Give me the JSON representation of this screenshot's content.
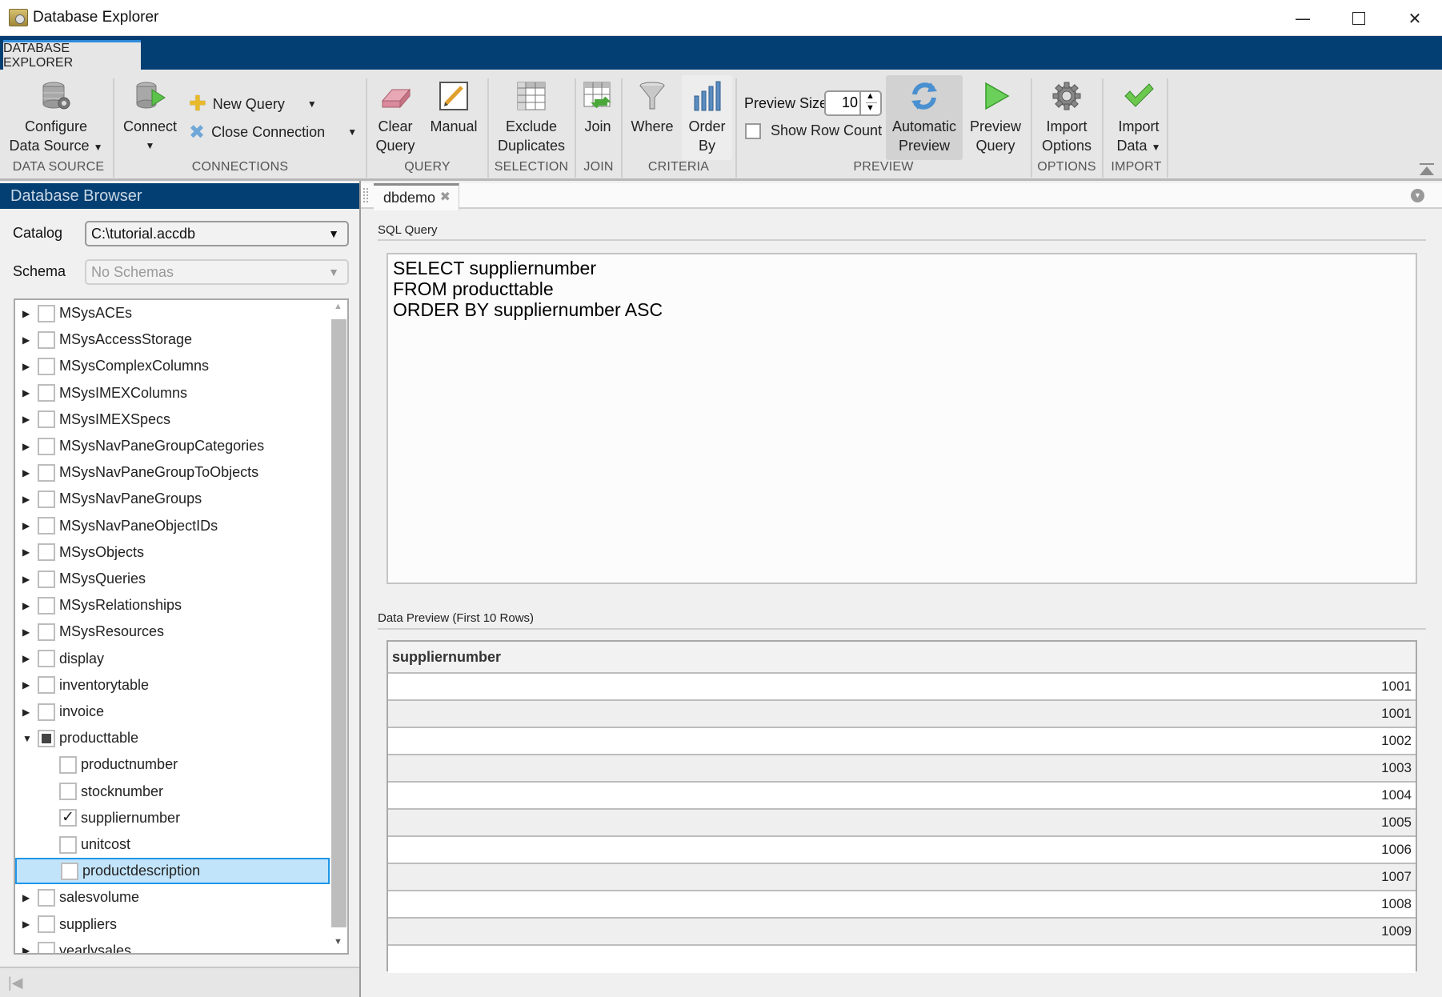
{
  "window": {
    "title": "Database Explorer",
    "controls": [
      "minimize",
      "maximize",
      "close"
    ]
  },
  "ribbon_tab": "DATABASE EXPLORER",
  "ribbon": {
    "groups": {
      "data_source": "DATA SOURCE",
      "connections": "CONNECTIONS",
      "query": "QUERY",
      "selection": "SELECTION",
      "join": "JOIN",
      "criteria": "CRITERIA",
      "preview": "PREVIEW",
      "options": "OPTIONS",
      "import": "IMPORT"
    },
    "configure": {
      "line1": "Configure",
      "line2": "Data Source"
    },
    "connect": "Connect",
    "new_query": "New Query",
    "close_connection": "Close Connection",
    "clear_query": {
      "line1": "Clear",
      "line2": "Query"
    },
    "manual": "Manual",
    "exclude_duplicates": {
      "line1": "Exclude",
      "line2": "Duplicates"
    },
    "join": "Join",
    "where": "Where",
    "order_by": {
      "line1": "Order",
      "line2": "By"
    },
    "preview_size_label": "Preview Size",
    "preview_size_value": "10",
    "show_row_count": {
      "label": "Show Row Count",
      "checked": false
    },
    "automatic_preview": {
      "line1": "Automatic",
      "line2": "Preview"
    },
    "preview_query": {
      "line1": "Preview",
      "line2": "Query"
    },
    "import_options": {
      "line1": "Import",
      "line2": "Options"
    },
    "import_data": {
      "line1": "Import",
      "line2": "Data"
    }
  },
  "browser": {
    "title": "Database Browser",
    "catalog_label": "Catalog",
    "catalog_value": "C:\\tutorial.accdb",
    "schema_label": "Schema",
    "schema_value": "No Schemas",
    "tree": [
      {
        "label": "MSysACEs",
        "level": 0,
        "expander": "collapsed",
        "check": "none"
      },
      {
        "label": "MSysAccessStorage",
        "level": 0,
        "expander": "collapsed",
        "check": "none"
      },
      {
        "label": "MSysComplexColumns",
        "level": 0,
        "expander": "collapsed",
        "check": "none"
      },
      {
        "label": "MSysIMEXColumns",
        "level": 0,
        "expander": "collapsed",
        "check": "none"
      },
      {
        "label": "MSysIMEXSpecs",
        "level": 0,
        "expander": "collapsed",
        "check": "none"
      },
      {
        "label": "MSysNavPaneGroupCategories",
        "level": 0,
        "expander": "collapsed",
        "check": "none"
      },
      {
        "label": "MSysNavPaneGroupToObjects",
        "level": 0,
        "expander": "collapsed",
        "check": "none"
      },
      {
        "label": "MSysNavPaneGroups",
        "level": 0,
        "expander": "collapsed",
        "check": "none"
      },
      {
        "label": "MSysNavPaneObjectIDs",
        "level": 0,
        "expander": "collapsed",
        "check": "none"
      },
      {
        "label": "MSysObjects",
        "level": 0,
        "expander": "collapsed",
        "check": "none"
      },
      {
        "label": "MSysQueries",
        "level": 0,
        "expander": "collapsed",
        "check": "none"
      },
      {
        "label": "MSysRelationships",
        "level": 0,
        "expander": "collapsed",
        "check": "none"
      },
      {
        "label": "MSysResources",
        "level": 0,
        "expander": "collapsed",
        "check": "none"
      },
      {
        "label": "display",
        "level": 0,
        "expander": "collapsed",
        "check": "none"
      },
      {
        "label": "inventorytable",
        "level": 0,
        "expander": "collapsed",
        "check": "none"
      },
      {
        "label": "invoice",
        "level": 0,
        "expander": "collapsed",
        "check": "none"
      },
      {
        "label": "producttable",
        "level": 0,
        "expander": "expanded",
        "check": "mixed"
      },
      {
        "label": "productnumber",
        "level": 1,
        "expander": "none",
        "check": "none"
      },
      {
        "label": "stocknumber",
        "level": 1,
        "expander": "none",
        "check": "none"
      },
      {
        "label": "suppliernumber",
        "level": 1,
        "expander": "none",
        "check": "checked"
      },
      {
        "label": "unitcost",
        "level": 1,
        "expander": "none",
        "check": "none"
      },
      {
        "label": "productdescription",
        "level": 1,
        "expander": "none",
        "check": "none",
        "selected": true
      },
      {
        "label": "salesvolume",
        "level": 0,
        "expander": "collapsed",
        "check": "none"
      },
      {
        "label": "suppliers",
        "level": 0,
        "expander": "collapsed",
        "check": "none"
      },
      {
        "label": "yearlysales",
        "level": 0,
        "expander": "collapsed",
        "check": "none"
      }
    ]
  },
  "editor": {
    "tab": "dbdemo",
    "sql_label": "SQL Query",
    "sql_text": "SELECT suppliernumber\nFROM producttable\nORDER BY suppliernumber ASC",
    "preview_label": "Data Preview (First 10 Rows)",
    "table": {
      "columns": [
        "suppliernumber"
      ],
      "rows": [
        "1001",
        "1001",
        "1002",
        "1003",
        "1004",
        "1005",
        "1006",
        "1007",
        "1008",
        "1009"
      ]
    }
  }
}
